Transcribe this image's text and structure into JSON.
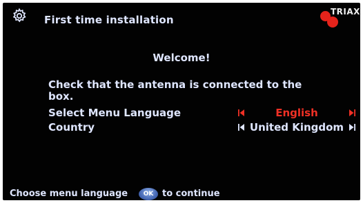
{
  "header": {
    "title": "First time installation",
    "logo_text": "TRIAX",
    "brand_color": "#e5231b"
  },
  "main": {
    "welcome": "Welcome!",
    "message": "Check that the antenna is connected to the box.",
    "settings": [
      {
        "label": "Select Menu Language",
        "value": "English",
        "state": "selected"
      },
      {
        "label": "Country",
        "value": "United Kingdom",
        "state": "normal"
      }
    ]
  },
  "footer": {
    "hint": "Choose menu language",
    "ok_label": "OK",
    "continue_text": "to continue"
  },
  "colors": {
    "background": "#020202",
    "text": "#dfe6ff",
    "highlight": "#f03025",
    "ok_button": "#4668b4"
  }
}
